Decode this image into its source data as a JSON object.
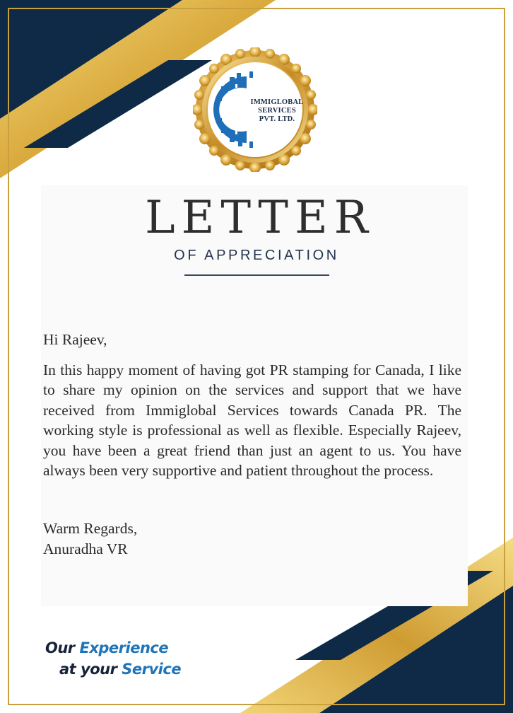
{
  "seal": {
    "line1": "IMMIGLOBAL",
    "line2": "SERVICES",
    "line3": "PVT. LTD."
  },
  "heading": {
    "title": "LETTER",
    "subtitle": "OF APPRECIATION"
  },
  "letter": {
    "greeting": "Hi Rajeev,",
    "body": "In this happy moment of having got PR stamping for Canada, I like to share my opinion on the services and support that we have received from Immiglobal Services towards Canada PR. The working style is professional as well as flexible. Especially Rajeev, you have been a great friend than just an agent to us. You have always been very supportive and patient throughout the process.",
    "closing": "Warm Regards,",
    "signature": "Anuradha VR"
  },
  "tagline": {
    "word1": "Our",
    "word2": "Experience",
    "word3": "at your",
    "word4": "Service"
  },
  "colors": {
    "navy": "#0e2a47",
    "gold": "#d4a637",
    "text": "#2a2a2a",
    "accent_blue": "#1e74b8"
  }
}
